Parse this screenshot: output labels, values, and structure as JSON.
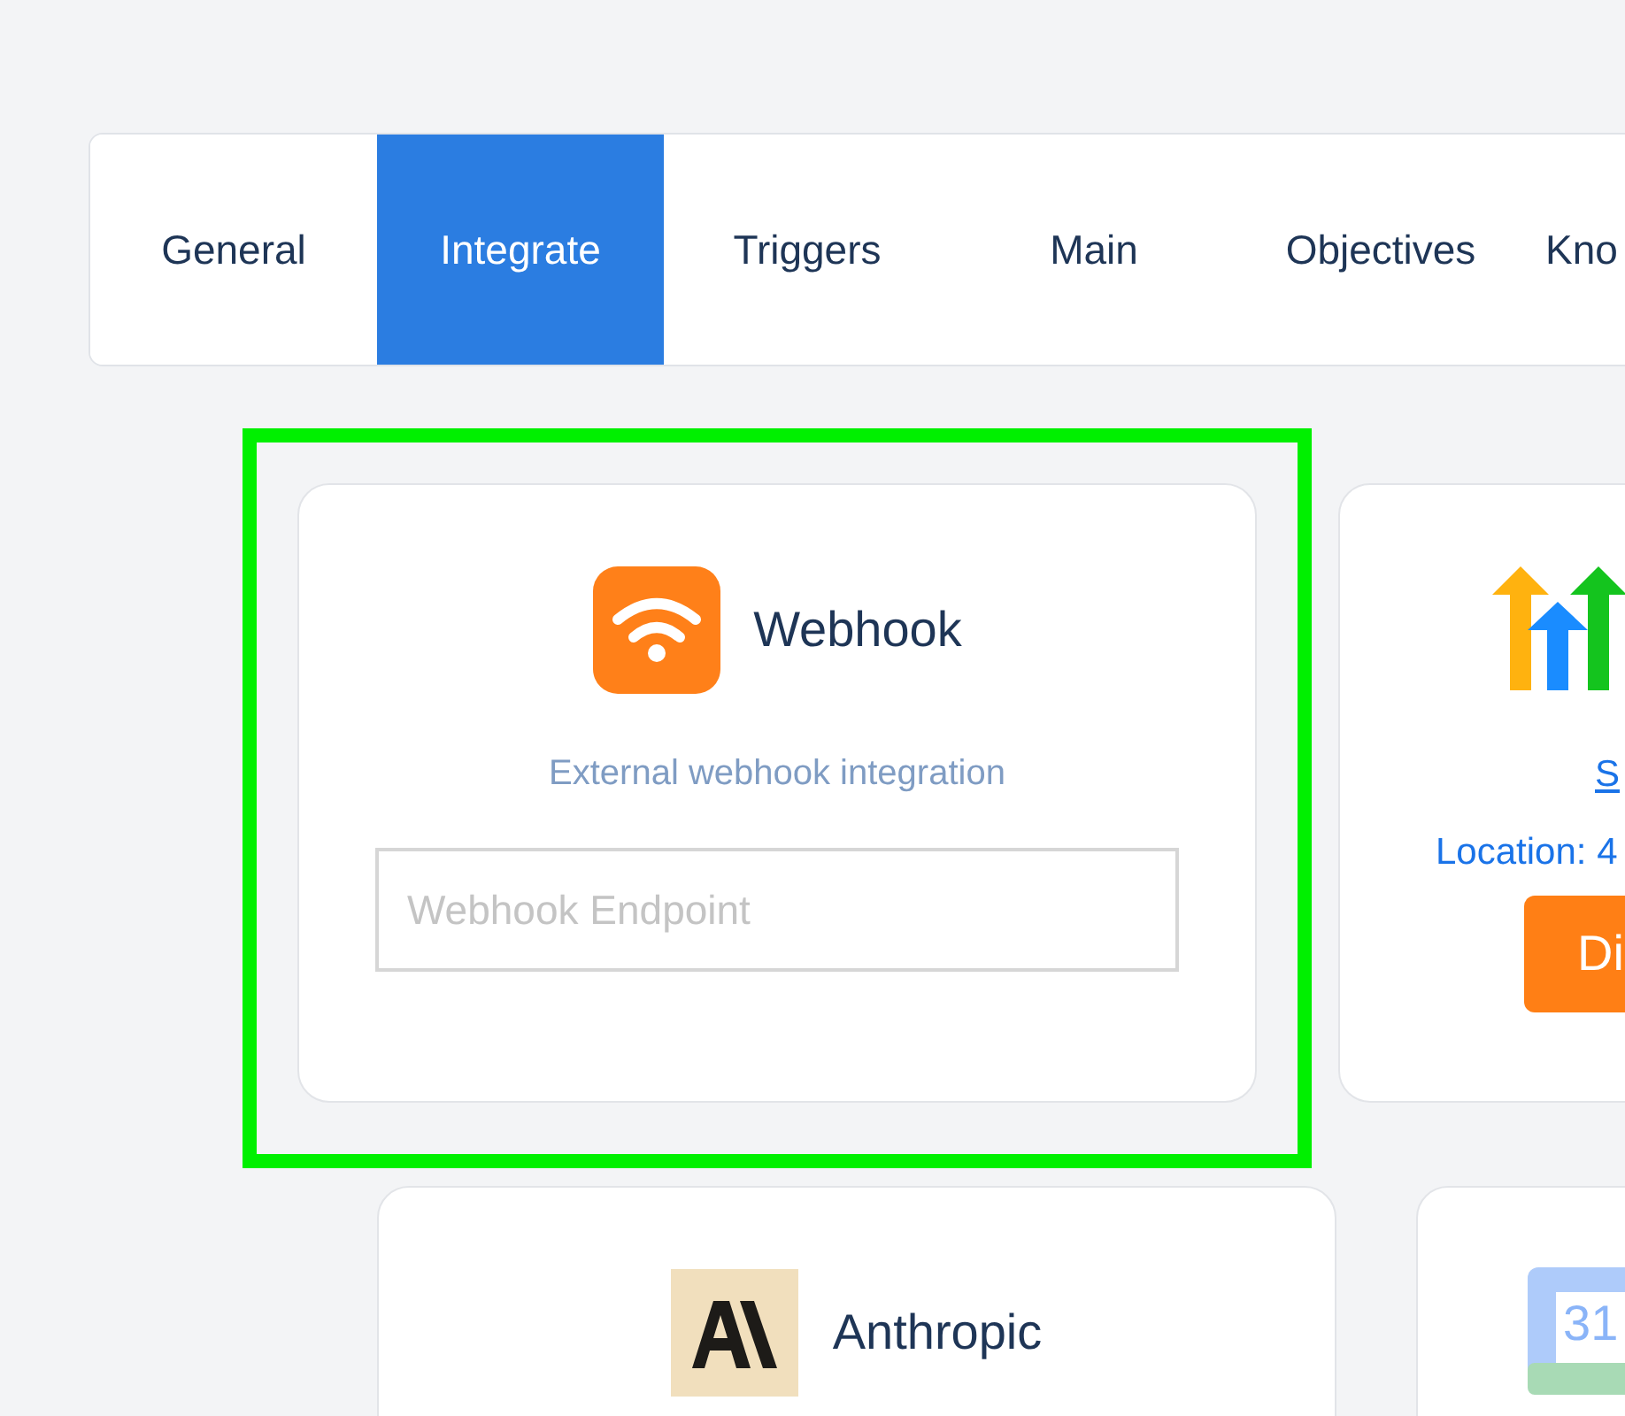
{
  "tabs": [
    {
      "label": "General",
      "selected": false
    },
    {
      "label": "Integrate",
      "selected": true
    },
    {
      "label": "Triggers",
      "selected": false
    },
    {
      "label": "Main",
      "selected": false
    },
    {
      "label": "Objectives",
      "selected": false
    },
    {
      "label": "Kno",
      "selected": false
    }
  ],
  "card_rows": [
    {
      "cards": [
        {
          "kind": "webhook",
          "title": "Webhook",
          "description": "External webhook integration",
          "field": {
            "placeholder": "Webhook Endpoint"
          }
        },
        {
          "kind": "arrows",
          "link": "S",
          "location": "Location: 4",
          "button": "Di"
        }
      ]
    },
    {
      "cards": [
        {
          "kind": "anthropic",
          "title": "Anthropic"
        },
        {
          "kind": "calendar",
          "icon_text": "31"
        }
      ]
    }
  ]
}
